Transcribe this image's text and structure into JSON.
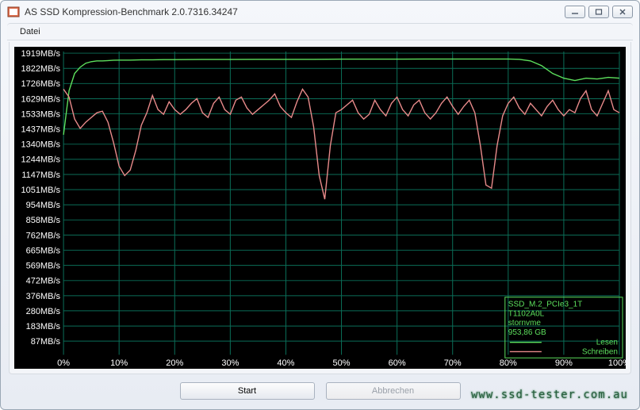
{
  "window": {
    "title": "AS SSD Kompression-Benchmark 2.0.7316.34247"
  },
  "menu": {
    "file": "Datei"
  },
  "buttons": {
    "start": "Start",
    "cancel": "Abbrechen"
  },
  "watermark": "www.ssd-tester.com.au",
  "device": {
    "line1": "SSD_M.2_PCIe3_1T",
    "line2": "T1102A0L",
    "line3": "stornvme",
    "line4": "953,86 GB"
  },
  "legend": {
    "read": "Lesen",
    "write": "Schreiben"
  },
  "chart_data": {
    "type": "line",
    "xlabel": "",
    "ylabel": "",
    "x_unit": "%",
    "y_unit": "MB/s",
    "xlim": [
      0,
      100
    ],
    "ylim": [
      0,
      1930
    ],
    "x_ticks": [
      0,
      10,
      20,
      30,
      40,
      50,
      60,
      70,
      80,
      90,
      100
    ],
    "y_ticks": [
      87,
      183,
      280,
      376,
      472,
      569,
      665,
      762,
      858,
      954,
      1051,
      1147,
      1244,
      1340,
      1437,
      1533,
      1629,
      1726,
      1822,
      1919
    ],
    "y_tick_labels": [
      "87MB/s",
      "183MB/s",
      "280MB/s",
      "376MB/s",
      "472MB/s",
      "569MB/s",
      "665MB/s",
      "762MB/s",
      "858MB/s",
      "954MB/s",
      "1051MB/s",
      "1147MB/s",
      "1244MB/s",
      "1340MB/s",
      "1437MB/s",
      "1533MB/s",
      "1629MB/s",
      "1726MB/s",
      "1822MB/s",
      "1919MB/s"
    ],
    "series": [
      {
        "name": "Lesen",
        "color": "#5de05d",
        "x": [
          0,
          1,
          2,
          3,
          4,
          5,
          6,
          7,
          8,
          9,
          10,
          12,
          14,
          16,
          18,
          20,
          25,
          30,
          35,
          40,
          45,
          50,
          55,
          60,
          65,
          70,
          75,
          80,
          82,
          84,
          86,
          88,
          90,
          92,
          94,
          96,
          98,
          100
        ],
        "y": [
          1400,
          1680,
          1790,
          1830,
          1855,
          1865,
          1870,
          1870,
          1872,
          1874,
          1875,
          1875,
          1877,
          1877,
          1878,
          1878,
          1879,
          1879,
          1880,
          1880,
          1880,
          1881,
          1881,
          1881,
          1882,
          1882,
          1882,
          1882,
          1880,
          1870,
          1840,
          1790,
          1760,
          1745,
          1760,
          1755,
          1765,
          1760
        ]
      },
      {
        "name": "Schreiben",
        "color": "#e88a8a",
        "x": [
          0,
          1,
          2,
          3,
          4,
          5,
          6,
          7,
          8,
          9,
          10,
          11,
          12,
          13,
          14,
          15,
          16,
          17,
          18,
          19,
          20,
          21,
          22,
          23,
          24,
          25,
          26,
          27,
          28,
          29,
          30,
          31,
          32,
          33,
          34,
          35,
          36,
          37,
          38,
          39,
          40,
          41,
          42,
          43,
          44,
          45,
          46,
          47,
          48,
          49,
          50,
          51,
          52,
          53,
          54,
          55,
          56,
          57,
          58,
          59,
          60,
          61,
          62,
          63,
          64,
          65,
          66,
          67,
          68,
          69,
          70,
          71,
          72,
          73,
          74,
          75,
          76,
          77,
          78,
          79,
          80,
          81,
          82,
          83,
          84,
          85,
          86,
          87,
          88,
          89,
          90,
          91,
          92,
          93,
          94,
          95,
          96,
          97,
          98,
          99,
          100
        ],
        "y": [
          1690,
          1640,
          1500,
          1440,
          1480,
          1510,
          1540,
          1550,
          1480,
          1350,
          1200,
          1140,
          1175,
          1300,
          1460,
          1540,
          1650,
          1560,
          1530,
          1610,
          1560,
          1530,
          1560,
          1600,
          1630,
          1540,
          1510,
          1600,
          1640,
          1560,
          1530,
          1620,
          1640,
          1570,
          1530,
          1560,
          1590,
          1620,
          1660,
          1580,
          1540,
          1510,
          1610,
          1690,
          1640,
          1450,
          1140,
          990,
          1330,
          1540,
          1560,
          1590,
          1620,
          1540,
          1500,
          1530,
          1620,
          1560,
          1520,
          1600,
          1640,
          1560,
          1520,
          1590,
          1620,
          1540,
          1500,
          1540,
          1600,
          1640,
          1580,
          1530,
          1580,
          1620,
          1540,
          1330,
          1080,
          1060,
          1330,
          1520,
          1600,
          1640,
          1570,
          1530,
          1600,
          1560,
          1520,
          1580,
          1620,
          1560,
          1520,
          1560,
          1540,
          1630,
          1680,
          1560,
          1520,
          1600,
          1680,
          1560,
          1540
        ]
      }
    ]
  }
}
